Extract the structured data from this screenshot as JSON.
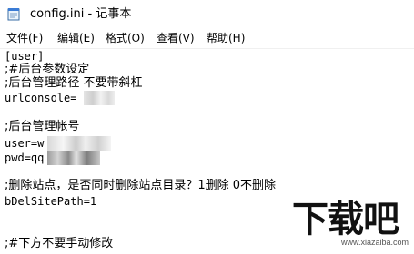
{
  "window": {
    "title": "config.ini - 记事本"
  },
  "menu": [
    {
      "label": "文件(F)"
    },
    {
      "label": "编辑(E)"
    },
    {
      "label": "格式(O)"
    },
    {
      "label": "查看(V)"
    },
    {
      "label": "帮助(H)"
    }
  ],
  "editor": {
    "lines": [
      "[user]",
      ";#后台参数设定",
      ";后台管理路径 不要带斜杠",
      "urlconsole=",
      "",
      ";后台管理帐号",
      "user=w",
      "pwd=qq",
      "",
      ";删除站点，是否同时删除站点目录？1删除 0不删除",
      "bDelSitePath=1",
      "",
      "",
      ";#下方不要手动修改"
    ]
  },
  "watermark": {
    "logo_text": "下载吧",
    "url": "www.xiazaiba.com"
  },
  "icons": {
    "app": "notepad-icon"
  },
  "colors": {
    "text": "#000000",
    "background": "#ffffff"
  }
}
